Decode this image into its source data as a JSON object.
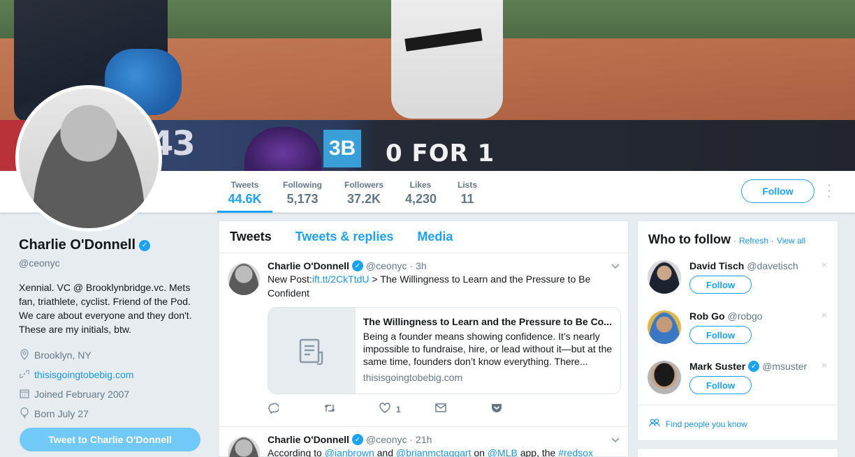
{
  "banner": {
    "score_num": "43",
    "base_tag": "3B",
    "at_bat": "0 FOR 1"
  },
  "nav": {
    "stats": [
      {
        "label": "Tweets",
        "value": "44.6K"
      },
      {
        "label": "Following",
        "value": "5,173"
      },
      {
        "label": "Followers",
        "value": "37.2K"
      },
      {
        "label": "Likes",
        "value": "4,230"
      },
      {
        "label": "Lists",
        "value": "11"
      }
    ],
    "follow_label": "Follow"
  },
  "profile": {
    "name": "Charlie O'Donnell",
    "handle": "@ceonyc",
    "bio": "Xennial. VC @ Brooklynbridge.vc. Mets fan, triathlete, cyclist. Friend of the Pod. We care about everyone and they don't. These are my initials, btw.",
    "location": "Brooklyn, NY",
    "website": "thisisgoingtobebig.com",
    "joined": "Joined February 2007",
    "born": "Born July 27",
    "tweet_to_label": "Tweet to Charlie O'Donnell"
  },
  "timeline": {
    "tabs": [
      "Tweets",
      "Tweets & replies",
      "Media"
    ],
    "tweets": [
      {
        "name": "Charlie O'Donnell",
        "handle": "@ceonyc",
        "time": "· 3h",
        "text_prefix": "New Post:",
        "link": "ift.tt/2CkTtdU",
        "text_suffix": " > The Willingness to Learn and the Pressure to Be Confident",
        "card_title": "The Willingness to Learn and the Pressure to Be Co...",
        "card_desc": "Being a founder means showing confidence. It’s nearly impossible to fundraise, hire, or lead without it—but at the same time, founders don’t know everything. There...",
        "card_url": "thisisgoingtobebig.com",
        "like_count": "1"
      },
      {
        "name": "Charlie O'Donnell",
        "handle": "@ceonyc",
        "time": "· 21h",
        "text_pre": "According to ",
        "mention1": "@ianbrown",
        "text_and": " and ",
        "mention2": "@brianmctaggart",
        "text_on": " on ",
        "mention3": "@MLB",
        "text_app": " app, the ",
        "hashtag": "#redsox"
      }
    ]
  },
  "who_to_follow": {
    "title": "Who to follow",
    "refresh": "Refresh",
    "view_all": "View all",
    "sep": "·",
    "suggestions": [
      {
        "name": "David Tisch",
        "handle": "@davetisch",
        "verified": false,
        "follow_label": "Follow"
      },
      {
        "name": "Rob Go",
        "handle": "@robgo",
        "verified": false,
        "follow_label": "Follow"
      },
      {
        "name": "Mark Suster",
        "handle": "@msuster",
        "verified": true,
        "follow_label": "Follow"
      }
    ],
    "find_people": "Find people you know"
  },
  "colors": {
    "accent": "#1da1f2",
    "link": "#1b95e0",
    "muted": "#657786",
    "background": "#e6ecf0"
  }
}
